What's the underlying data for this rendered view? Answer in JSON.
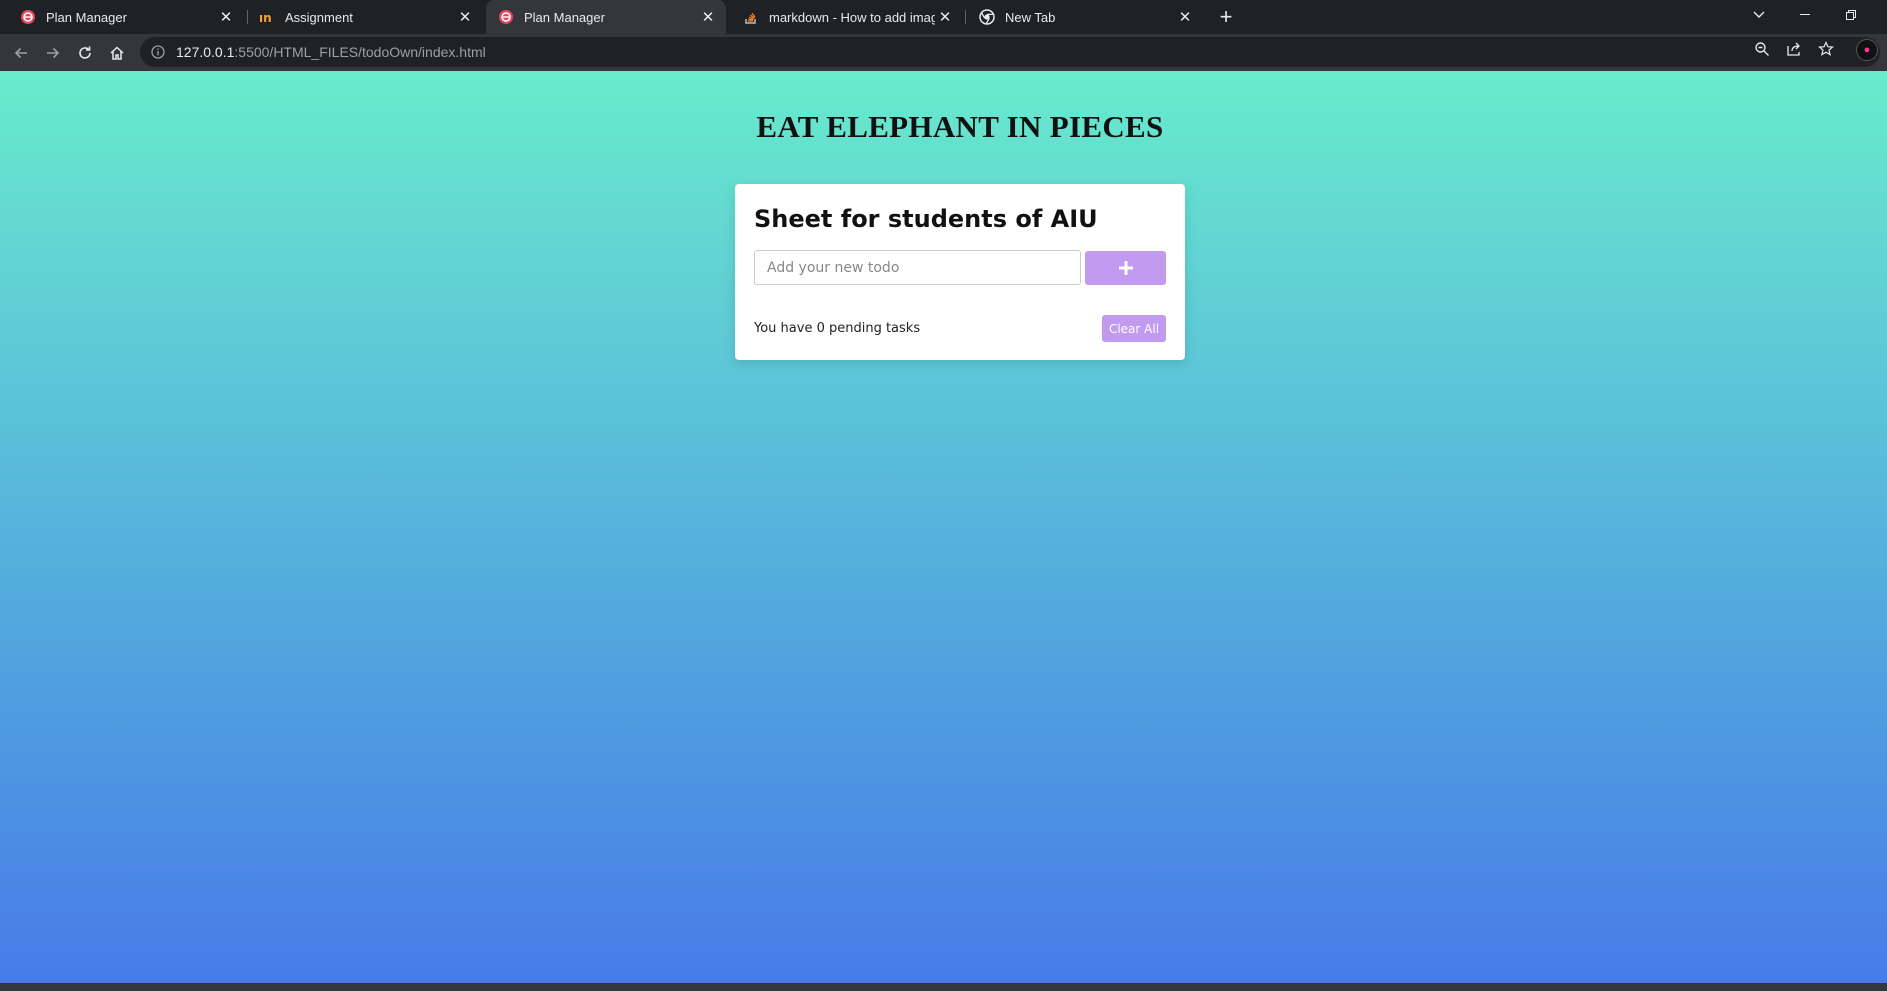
{
  "browser": {
    "tabs": [
      {
        "title": "Plan Manager",
        "icon": "plan-manager-icon",
        "active": false
      },
      {
        "title": "Assignment",
        "icon": "assignment-icon",
        "active": false
      },
      {
        "title": "Plan Manager",
        "icon": "plan-manager-icon",
        "active": true
      },
      {
        "title": "markdown - How to add images",
        "icon": "stackoverflow-icon",
        "active": false
      },
      {
        "title": "New Tab",
        "icon": "chrome-icon",
        "active": false
      }
    ],
    "url_host": "127.0.0.1",
    "url_rest": ":5500/HTML_FILES/todoOwn/index.html"
  },
  "page": {
    "heading": "EAT ELEPHANT IN PIECES",
    "card": {
      "title": "Sheet for students of AIU",
      "input_placeholder": "Add your new todo",
      "input_value": "",
      "add_button_icon": "plus-icon",
      "pending_text": "You have 0 pending tasks",
      "clear_label": "Clear All"
    }
  },
  "colors": {
    "accent": "#c29af0",
    "gradient_top": "#68ebcc",
    "gradient_bottom": "#487be8"
  }
}
